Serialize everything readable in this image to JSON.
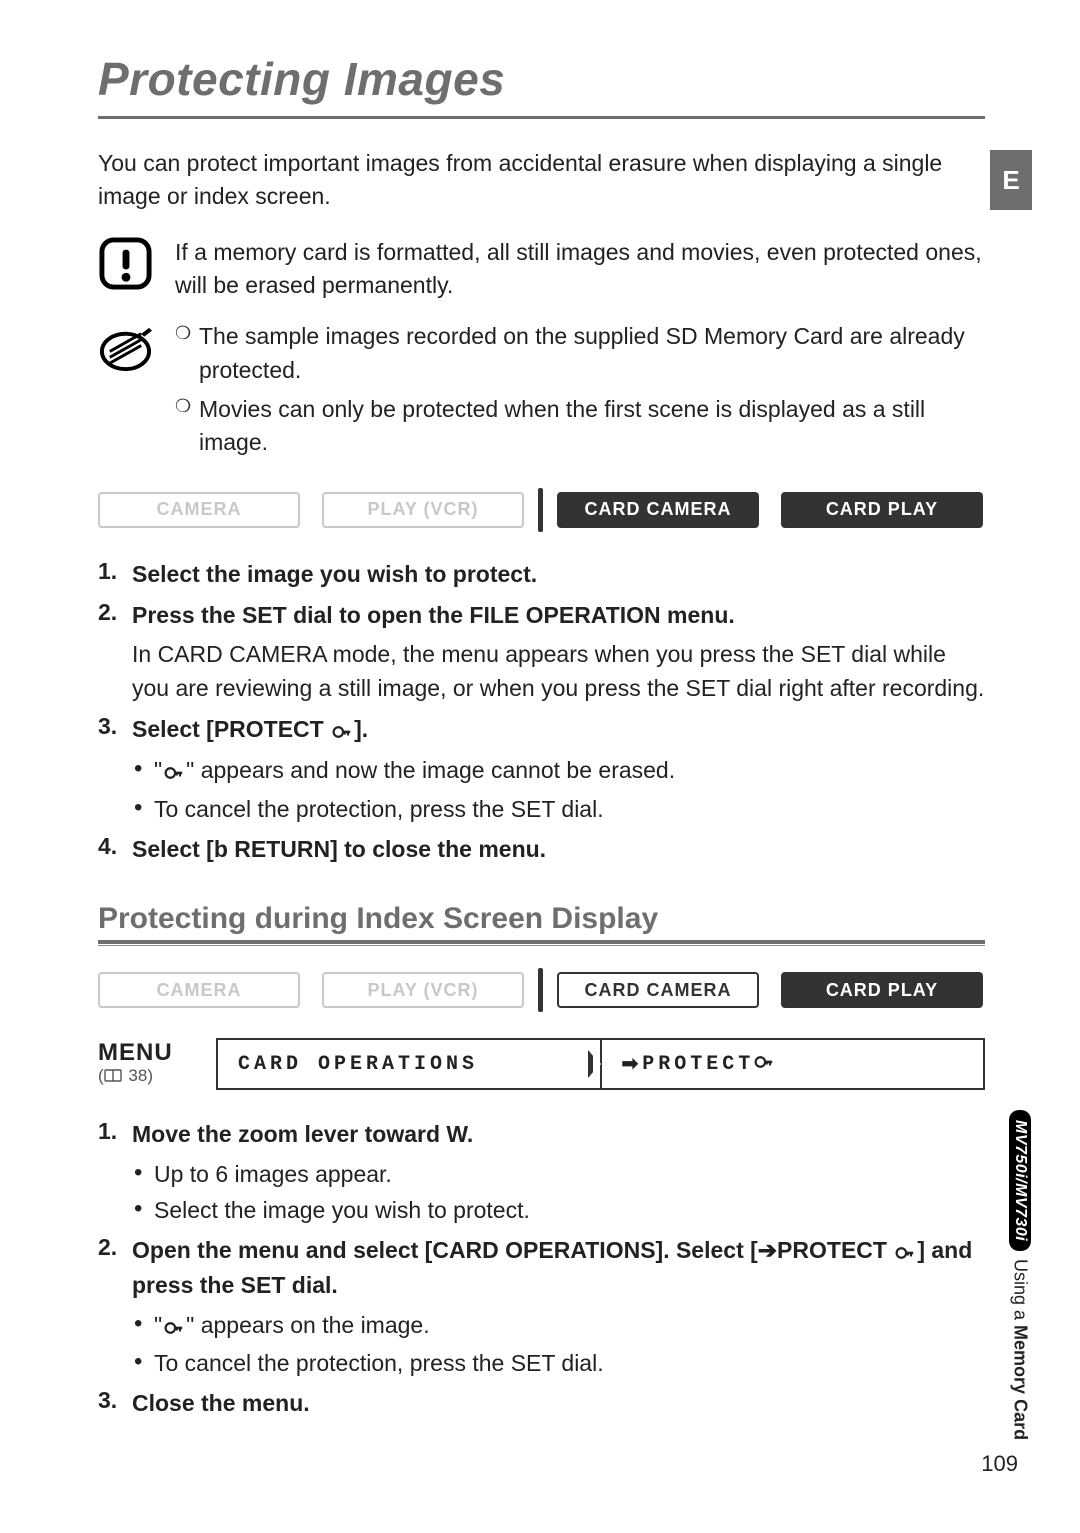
{
  "language_tab": "E",
  "title": "Protecting Images",
  "intro": "You can protect important images from accidental erasure when displaying a single image or index screen.",
  "warning": "If a memory card is formatted, all still images and movies, even protected ones, will be erased permanently.",
  "info_items": [
    "The sample images recorded on the supplied SD Memory Card are already protected.",
    "Movies can only be protected when the first scene is displayed as a still image."
  ],
  "modes_row1": {
    "items": [
      "CAMERA",
      "PLAY (VCR)",
      "CARD CAMERA",
      "CARD PLAY"
    ],
    "active": [
      false,
      false,
      true,
      true
    ]
  },
  "steps1": [
    {
      "title": "Select the image you wish to protect."
    },
    {
      "title": "Press the SET dial to open the FILE OPERATION menu.",
      "sub": "In CARD CAMERA mode, the menu appears when you press the SET dial while you are reviewing a still image, or when you press the SET dial right after recording."
    },
    {
      "title_prefix": "Select [PROTECT ",
      "title_suffix": "].",
      "bullets": [
        {
          "pre": "\"",
          "icon": true,
          "post": "\" appears and now the image cannot be erased."
        },
        {
          "text": "To cancel the protection, press the SET dial."
        }
      ]
    },
    {
      "title": "Select [b RETURN] to close the menu."
    }
  ],
  "section2_heading": "Protecting during Index Screen Display",
  "modes_row2": {
    "items": [
      "CAMERA",
      "PLAY (VCR)",
      "CARD CAMERA",
      "CARD PLAY"
    ],
    "active_index": 3
  },
  "menu_strip": {
    "menu_word": "MENU",
    "ref_page": "38",
    "cell1": "CARD OPERATIONS",
    "cell2_prefix": "PROTECT"
  },
  "steps2": [
    {
      "title": "Move the zoom lever toward W.",
      "bullets": [
        {
          "text": "Up to 6 images appear."
        },
        {
          "text": "Select the image you wish to protect."
        }
      ]
    },
    {
      "title_prefix": "Open the menu and select [CARD OPERATIONS]. Select [➔PROTECT ",
      "title_suffix": "] and press the SET dial.",
      "bullets": [
        {
          "pre": "\"",
          "icon": true,
          "post": "\" appears on the image."
        },
        {
          "text": "To cancel the protection, press the SET dial."
        }
      ]
    },
    {
      "title": "Close the menu."
    }
  ],
  "side_label": {
    "model": "MV750i/MV730i",
    "prefix": "Using a ",
    "bold": "Memory Card"
  },
  "page_number": "109"
}
